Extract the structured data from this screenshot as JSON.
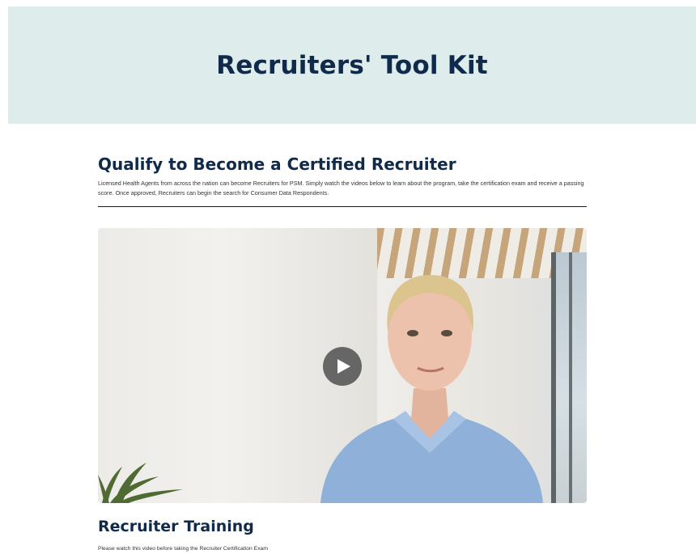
{
  "hero": {
    "title": "Recruiters' Tool Kit",
    "background_color": "#dfecec",
    "title_color": "#0f2a4a"
  },
  "qualify": {
    "title": "Qualify to Become a Certified Recruiter",
    "description": "Licensed Health Agents from across the nation can become Recruiters for PSM.   Simply watch the videos below to learn about the program, take the certification exam and receive a passing score.  Once approved, Recruiters can begin the search for Consumer Data Respondents."
  },
  "video": {
    "play_icon": "play-icon"
  },
  "training": {
    "title": "Recruiter Training",
    "note": "Please watch this video before taking the Recruiter Certification Exam"
  }
}
